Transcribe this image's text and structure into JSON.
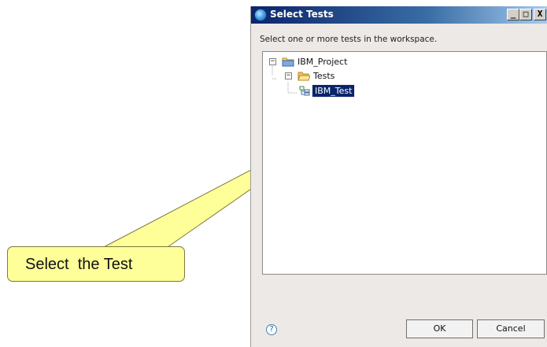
{
  "dialog": {
    "title": "Select Tests",
    "instruction": "Select one or more tests in the workspace.",
    "window_controls": {
      "minimize": "_",
      "maximize": "□",
      "close": "X"
    },
    "tree": [
      {
        "label": "IBM_Project",
        "icon": "project-folder-icon",
        "expanded": true
      },
      {
        "label": "Tests",
        "icon": "folder-icon",
        "expanded": true
      },
      {
        "label": "IBM_Test",
        "icon": "test-icon",
        "selected": true
      }
    ],
    "help_glyph": "?",
    "buttons": {
      "ok": "OK",
      "cancel": "Cancel"
    }
  },
  "callout": {
    "text": "Select  the Test",
    "color": "#ffff99"
  },
  "colors": {
    "title_bar": "#0a246a",
    "selection": "#0a246a"
  }
}
